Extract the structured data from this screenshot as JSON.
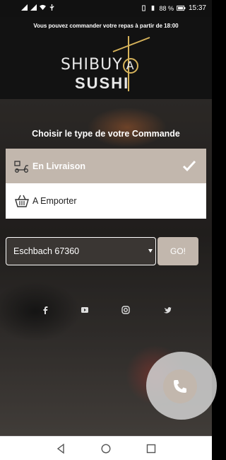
{
  "status_bar": {
    "battery": "88 %",
    "time": "15:37"
  },
  "header": {
    "notice": "Vous pouvez commander votre repas à partir de 18:00",
    "logo_top": "SHIBUY",
    "logo_a": "A",
    "logo_bottom": "SUSHI"
  },
  "order": {
    "title": "Choisir le type de votre Commande",
    "delivery_label": "En Livraison",
    "takeaway_label": "A Emporter",
    "city_value": "Eschbach 67360",
    "go_label": "GO!"
  },
  "icons": {
    "delivery": "scooter-icon",
    "takeaway": "basket-icon",
    "selected": "check-icon",
    "social": [
      "facebook-icon",
      "youtube-icon",
      "instagram-icon",
      "twitter-icon"
    ],
    "call": "phone-icon",
    "nav": [
      "back-icon",
      "home-icon",
      "recents-icon"
    ]
  },
  "colors": {
    "accent": "#c2b7ad",
    "logo_gold": "#d6b35b",
    "header_bg": "#121212"
  }
}
